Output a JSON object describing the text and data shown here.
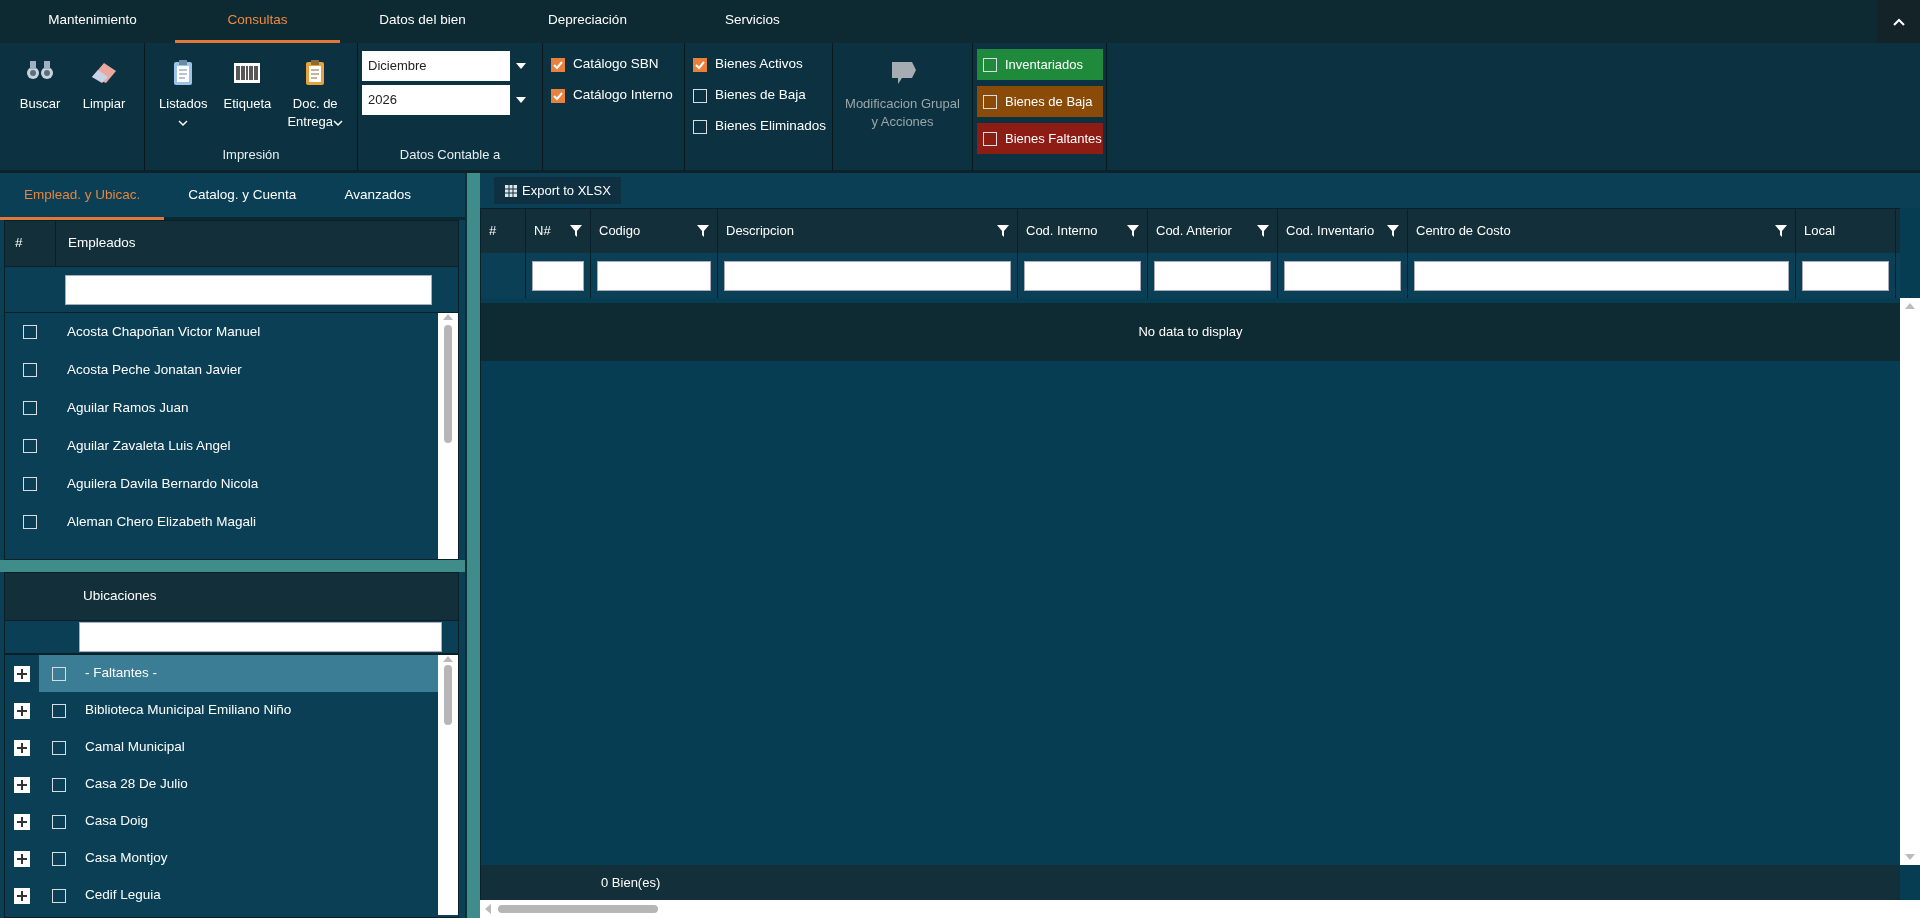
{
  "menu_tabs": [
    {
      "label": "Mantenimiento",
      "selected": false
    },
    {
      "label": "Consultas",
      "selected": true
    },
    {
      "label": "Datos del bien",
      "selected": false
    },
    {
      "label": "Depreciación",
      "selected": false
    },
    {
      "label": "Servicios",
      "selected": false
    }
  ],
  "ribbon": {
    "groups": [
      {
        "kind": "buttons",
        "buttons": [
          {
            "label": "Buscar",
            "dropdown": false,
            "disabled": false
          },
          {
            "label": "Limpiar",
            "dropdown": false,
            "disabled": false
          }
        ]
      },
      {
        "kind": "buttons",
        "label": "Impresión",
        "buttons": [
          {
            "label": "Listados",
            "dropdown": true,
            "disabled": false
          },
          {
            "label": "Etiqueta",
            "dropdown": false,
            "disabled": false
          },
          {
            "label": "Doc. de Entrega",
            "dropdown": true,
            "disabled": false
          }
        ]
      },
      {
        "kind": "dropdowns",
        "label": "Datos Contable a",
        "dropdowns": [
          {
            "value": "Diciembre"
          },
          {
            "value": "2026"
          }
        ]
      },
      {
        "kind": "checks",
        "items": [
          {
            "label": "Catálogo SBN",
            "checked": true
          },
          {
            "label": "Catálogo Interno",
            "checked": true
          }
        ]
      },
      {
        "kind": "checks",
        "items": [
          {
            "label": "Bienes Activos",
            "checked": true
          },
          {
            "label": "Bienes de Baja",
            "checked": false
          },
          {
            "label": "Bienes Eliminados",
            "checked": false
          }
        ]
      },
      {
        "kind": "buttons",
        "buttons": [
          {
            "label": "Modificacion Grupal y Acciones",
            "dropdown": false,
            "disabled": true
          }
        ]
      },
      {
        "kind": "legend",
        "items": [
          {
            "label": "Inventariados",
            "checked": false,
            "color": "#1f8a3c"
          },
          {
            "label": "Bienes de Baja",
            "checked": false,
            "color": "#8a4a08"
          },
          {
            "label": "Bienes Faltantes",
            "checked": false,
            "color": "#8c1c14"
          }
        ]
      }
    ]
  },
  "left_tabs": [
    {
      "label": "Emplead. y Ubicac.",
      "selected": true
    },
    {
      "label": "Catalog. y Cuenta",
      "selected": false
    },
    {
      "label": "Avanzados",
      "selected": false
    }
  ],
  "employees": {
    "columns": [
      "#",
      "Empleados"
    ],
    "rows": [
      {
        "name": "Acosta Chapoñan Victor Manuel",
        "checked": false
      },
      {
        "name": "Acosta Peche Jonatan Javier",
        "checked": false
      },
      {
        "name": "Aguilar Ramos Juan",
        "checked": false
      },
      {
        "name": "Aguilar Zavaleta Luis Angel",
        "checked": false
      },
      {
        "name": "Aguilera Davila Bernardo Nicola",
        "checked": false
      },
      {
        "name": "Aleman Chero Elizabeth Magali",
        "checked": false
      }
    ]
  },
  "locations": {
    "column": "Ubicaciones",
    "rows": [
      {
        "name": "- Faltantes -",
        "checked": false,
        "selected": true,
        "expanded": false
      },
      {
        "name": "Biblioteca Municipal Emiliano Niño",
        "checked": false,
        "selected": false,
        "expanded": false
      },
      {
        "name": "Camal Municipal",
        "checked": false,
        "selected": false,
        "expanded": false
      },
      {
        "name": "Casa 28 De Julio",
        "checked": false,
        "selected": false,
        "expanded": false
      },
      {
        "name": "Casa Doig",
        "checked": false,
        "selected": false,
        "expanded": false
      },
      {
        "name": "Casa Montjoy",
        "checked": false,
        "selected": false,
        "expanded": false
      },
      {
        "name": "Cedif Leguia",
        "checked": false,
        "selected": false,
        "expanded": false
      }
    ]
  },
  "grid": {
    "toolbar_button": "Export to XLSX",
    "columns": [
      {
        "label": "#",
        "filter": false
      },
      {
        "label": "N#",
        "filter": true
      },
      {
        "label": "Codigo",
        "filter": true
      },
      {
        "label": "Descripcion",
        "filter": true
      },
      {
        "label": "Cod. Interno",
        "filter": true
      },
      {
        "label": "Cod. Anterior",
        "filter": true
      },
      {
        "label": "Cod. Inventario",
        "filter": true
      },
      {
        "label": "Centro de Costo",
        "filter": true
      },
      {
        "label": "Local",
        "filter": false
      }
    ],
    "empty_text": "No data to display",
    "footer": "0 Bien(es)"
  }
}
